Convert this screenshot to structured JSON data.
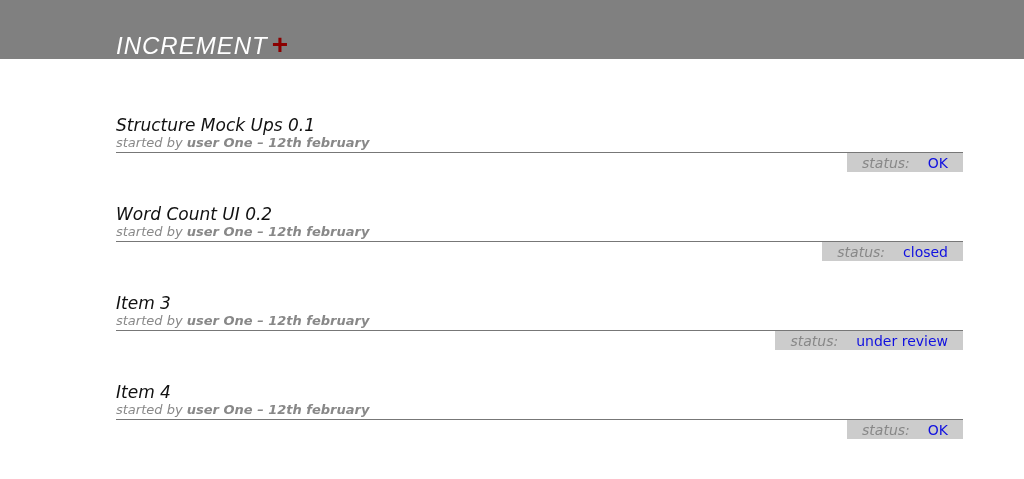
{
  "header": {
    "logo": "INCREMENT",
    "logo_mark": "+"
  },
  "items": [
    {
      "title": "Structure Mock Ups 0.1",
      "byline": "started by **user One – 12th february**",
      "status_label": "status:",
      "status": "OK"
    },
    {
      "title": "Word Count UI 0.2",
      "byline": "started by **user One – 12th february**",
      "status_label": "status:",
      "status": "closed"
    },
    {
      "title": "Item 3",
      "byline": "started by **user One – 12th february**",
      "status_label": "status:",
      "status": "under review"
    },
    {
      "title": "Item 4",
      "byline": "started by **user One – 12th february**",
      "status_label": "status:",
      "status": "OK"
    }
  ]
}
